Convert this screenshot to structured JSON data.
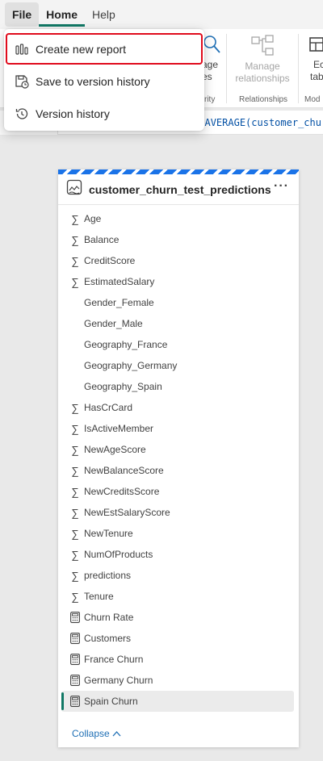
{
  "menubar": {
    "tabs": [
      {
        "label": "File"
      },
      {
        "label": "Home"
      },
      {
        "label": "Help"
      }
    ]
  },
  "file_menu": {
    "items": [
      {
        "label": "Create new report",
        "icon": "report-icon",
        "highlighted": true
      },
      {
        "label": "Save to version history",
        "icon": "save-history-icon"
      },
      {
        "label": "Version history",
        "icon": "history-icon"
      }
    ]
  },
  "ribbon": {
    "manage_roles_partial": "age\nes",
    "manage_roles_line1": "age",
    "manage_roles_line2": "es",
    "security_group_partial": "rity",
    "manage_relationships_line1": "Manage",
    "manage_relationships_line2": "relationships",
    "relationships_group": "Relationships",
    "edit_tables_line1": "Ec",
    "edit_tables_line2": "tab",
    "model_group_partial": "Mod"
  },
  "formula_bar": {
    "code": "(AVERAGE(customer_churn"
  },
  "table_card": {
    "title": "customer_churn_test_predictions",
    "more_label": "···",
    "fields": [
      {
        "label": "Age",
        "icon": "sigma"
      },
      {
        "label": "Balance",
        "icon": "sigma"
      },
      {
        "label": "CreditScore",
        "icon": "sigma"
      },
      {
        "label": "EstimatedSalary",
        "icon": "sigma"
      },
      {
        "label": "Gender_Female",
        "icon": "none"
      },
      {
        "label": "Gender_Male",
        "icon": "none"
      },
      {
        "label": "Geography_France",
        "icon": "none"
      },
      {
        "label": "Geography_Germany",
        "icon": "none"
      },
      {
        "label": "Geography_Spain",
        "icon": "none"
      },
      {
        "label": "HasCrCard",
        "icon": "sigma"
      },
      {
        "label": "IsActiveMember",
        "icon": "sigma"
      },
      {
        "label": "NewAgeScore",
        "icon": "sigma"
      },
      {
        "label": "NewBalanceScore",
        "icon": "sigma"
      },
      {
        "label": "NewCreditsScore",
        "icon": "sigma"
      },
      {
        "label": "NewEstSalaryScore",
        "icon": "sigma"
      },
      {
        "label": "NewTenure",
        "icon": "sigma"
      },
      {
        "label": "NumOfProducts",
        "icon": "sigma"
      },
      {
        "label": "predictions",
        "icon": "sigma"
      },
      {
        "label": "Tenure",
        "icon": "sigma"
      },
      {
        "label": "Churn Rate",
        "icon": "calculator"
      },
      {
        "label": "Customers",
        "icon": "calculator"
      },
      {
        "label": "France Churn",
        "icon": "calculator"
      },
      {
        "label": "Germany Churn",
        "icon": "calculator"
      },
      {
        "label": "Spain Churn",
        "icon": "calculator",
        "selected": true
      }
    ],
    "collapse_label": "Collapse"
  },
  "colors": {
    "accent": "#117865",
    "highlight_border": "#e00b1c",
    "stripe": "#1a73e8",
    "link": "#1f6fb5"
  }
}
